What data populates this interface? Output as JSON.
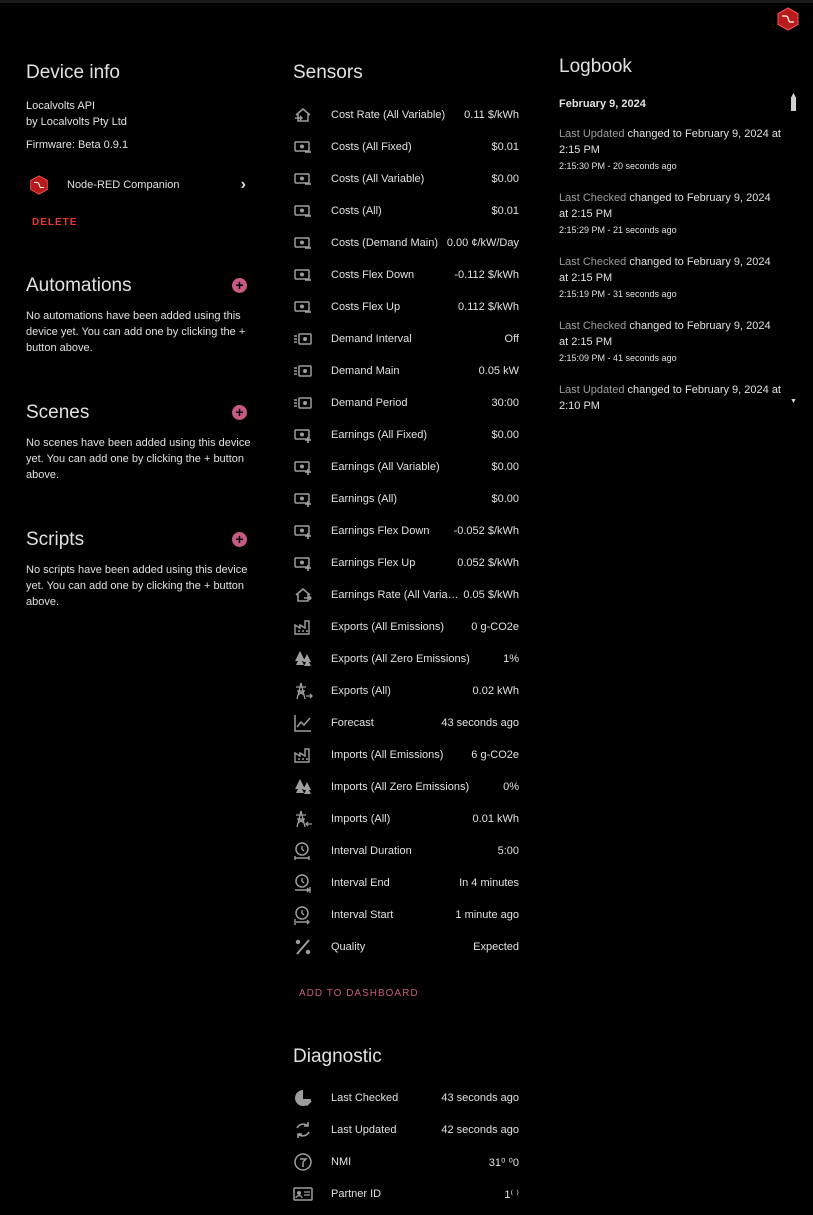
{
  "colors": {
    "accent": "#c65a83",
    "danger": "#e53935",
    "background": "#000000",
    "icon": "#9e9e9e"
  },
  "device_info": {
    "title": "Device info",
    "name": "Localvolts API",
    "manufacturer": "by Localvolts Pty Ltd",
    "firmware": "Firmware: Beta 0.9.1",
    "integration": {
      "label": "Node-RED Companion",
      "icon": "node-red-icon"
    },
    "delete_label": "DELETE"
  },
  "automations": {
    "title": "Automations",
    "text": "No automations have been added using this device yet. You can add one by clicking the + button above."
  },
  "scenes": {
    "title": "Scenes",
    "text": "No scenes have been added using this device yet. You can add one by clicking the + button above."
  },
  "scripts": {
    "title": "Scripts",
    "text": "No scripts have been added using this device yet. You can add one by clicking the + button above."
  },
  "sensors": {
    "title": "Sensors",
    "items": [
      {
        "name": "Cost Rate (All Variable)",
        "value": "0.11 $/kWh",
        "icon": "home-import-icon"
      },
      {
        "name": "Costs (All Fixed)",
        "value": "$0.01",
        "icon": "cash-minus-icon"
      },
      {
        "name": "Costs (All Variable)",
        "value": "$0.00",
        "icon": "cash-minus-icon"
      },
      {
        "name": "Costs (All)",
        "value": "$0.01",
        "icon": "cash-minus-icon"
      },
      {
        "name": "Costs (Demand Main)",
        "value": "0.00 ¢/kW/Day",
        "icon": "cash-minus-icon"
      },
      {
        "name": "Costs Flex Down",
        "value": "-0.112 $/kWh",
        "icon": "cash-minus-icon"
      },
      {
        "name": "Costs Flex Up",
        "value": "0.112 $/kWh",
        "icon": "cash-minus-icon"
      },
      {
        "name": "Demand Interval",
        "value": "Off",
        "icon": "cash-fast-icon"
      },
      {
        "name": "Demand Main",
        "value": "0.05 kW",
        "icon": "cash-fast-icon"
      },
      {
        "name": "Demand Period",
        "value": "30:00",
        "icon": "cash-fast-icon"
      },
      {
        "name": "Earnings (All Fixed)",
        "value": "$0.00",
        "icon": "cash-plus-icon"
      },
      {
        "name": "Earnings (All Variable)",
        "value": "$0.00",
        "icon": "cash-plus-icon"
      },
      {
        "name": "Earnings (All)",
        "value": "$0.00",
        "icon": "cash-plus-icon"
      },
      {
        "name": "Earnings Flex Down",
        "value": "-0.052 $/kWh",
        "icon": "cash-plus-icon"
      },
      {
        "name": "Earnings Flex Up",
        "value": "0.052 $/kWh",
        "icon": "cash-plus-icon"
      },
      {
        "name": "Earnings Rate (All Variable)",
        "value": "0.05 $/kWh",
        "icon": "home-export-icon"
      },
      {
        "name": "Exports (All Emissions)",
        "value": "0 g-CO2e",
        "icon": "factory-icon"
      },
      {
        "name": "Exports (All Zero Emissions)",
        "value": "1%",
        "icon": "pine-tree-icon"
      },
      {
        "name": "Exports (All)",
        "value": "0.02 kWh",
        "icon": "transmission-tower-export-icon"
      },
      {
        "name": "Forecast",
        "value": "43 seconds ago",
        "icon": "chart-line-icon"
      },
      {
        "name": "Imports (All Emissions)",
        "value": "6 g-CO2e",
        "icon": "factory-icon"
      },
      {
        "name": "Imports (All Zero Emissions)",
        "value": "0%",
        "icon": "pine-tree-icon"
      },
      {
        "name": "Imports (All)",
        "value": "0.01 kWh",
        "icon": "transmission-tower-import-icon"
      },
      {
        "name": "Interval Duration",
        "value": "5:00",
        "icon": "clock-interval-icon"
      },
      {
        "name": "Interval End",
        "value": "In 4 minutes",
        "icon": "clock-end-icon"
      },
      {
        "name": "Interval Start",
        "value": "1 minute ago",
        "icon": "clock-start-icon"
      },
      {
        "name": "Quality",
        "value": "Expected",
        "icon": "percent-icon"
      }
    ],
    "add_to_dashboard": "ADD TO DASHBOARD"
  },
  "diagnostic": {
    "title": "Diagnostic",
    "items": [
      {
        "name": "Last Checked",
        "value": "43 seconds ago",
        "icon": "clock-check-icon"
      },
      {
        "name": "Last Updated",
        "value": "42 seconds ago",
        "icon": "update-icon"
      },
      {
        "name": "NMI",
        "value": "31⁰ ⁰0",
        "icon": "meter-icon"
      },
      {
        "name": "Partner ID",
        "value": "1⁽ ⁾",
        "icon": "card-account-icon"
      }
    ]
  },
  "logbook": {
    "title": "Logbook",
    "date": "February 9, 2024",
    "entries": [
      {
        "name": "Last Updated",
        "text": "changed to February 9, 2024 at 2:15 PM",
        "time": "2:15:30 PM - 20 seconds ago"
      },
      {
        "name": "Last Checked",
        "text": "changed to February 9, 2024 at 2:15 PM",
        "time": "2:15:29 PM - 21 seconds ago"
      },
      {
        "name": "Last Checked",
        "text": "changed to February 9, 2024 at 2:15 PM",
        "time": "2:15:19 PM - 31 seconds ago"
      },
      {
        "name": "Last Checked",
        "text": "changed to February 9, 2024 at 2:15 PM",
        "time": "2:15:09 PM - 41 seconds ago"
      },
      {
        "name": "Last Updated",
        "text": "changed to February 9, 2024 at 2:10 PM",
        "time": ""
      }
    ]
  }
}
